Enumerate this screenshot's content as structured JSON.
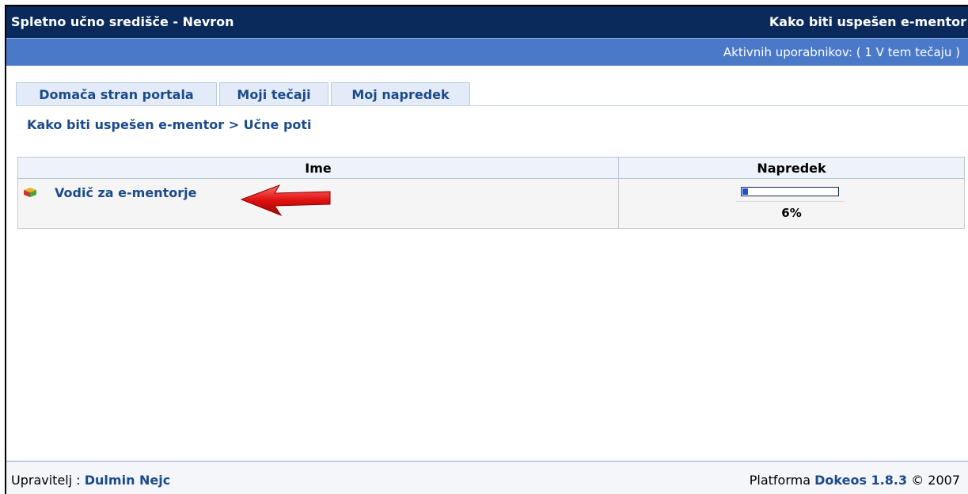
{
  "header": {
    "site_title": "Spletno učno središče - Nevron",
    "course_title": "Kako biti uspešen e-mentor",
    "active_users": "Aktivnih uporabnikov: ( 1 V tem tečaju )"
  },
  "tabs": [
    {
      "label": "Domača stran portala"
    },
    {
      "label": "Moji tečaji"
    },
    {
      "label": "Moj napredek"
    }
  ],
  "breadcrumb": {
    "course": "Kako biti uspešen e-mentor",
    "separator": ">",
    "current": "Učne poti"
  },
  "table": {
    "columns": [
      "Ime",
      "Napredek"
    ],
    "rows": [
      {
        "name": "Vodič za e-mentorje",
        "progress_label": "6%",
        "progress_value": 0.06
      }
    ]
  },
  "footer": {
    "admin_prefix": "Upravitelj :",
    "admin_name": "Dulmin Nejc",
    "platform_prefix": "Platforma",
    "platform_name": "Dokeos 1.8.3",
    "copyright": "© 2007"
  },
  "colors": {
    "topbar": "#0a2a5c",
    "subbar": "#4a79c9",
    "link": "#1b4a8c",
    "progress_fill": "#1f4fd1",
    "arrow": "#e01010"
  },
  "icons": {
    "learning_path": "learning-path-cube-icon",
    "annotation": "red-arrow-annotation"
  }
}
